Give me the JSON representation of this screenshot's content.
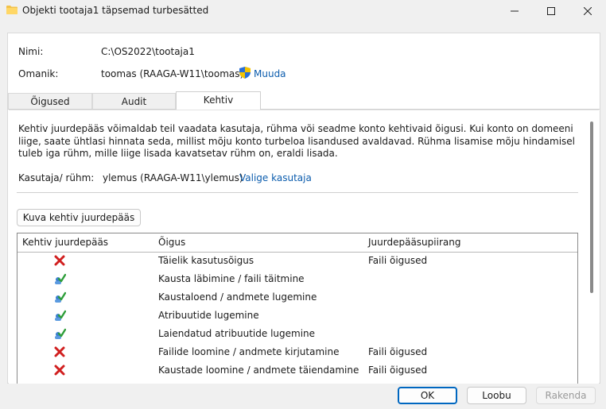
{
  "window": {
    "title": "Objekti tootaja1 täpsemad turbesätted"
  },
  "header": {
    "name_label": "Nimi:",
    "name_value": "C:\\OS2022\\tootaja1",
    "owner_label": "Omanik:",
    "owner_value": "toomas (RAAGA-W11\\toomas)",
    "change_link": "Muuda"
  },
  "tabs": [
    {
      "label": "Õigused"
    },
    {
      "label": "Audit"
    },
    {
      "label": "Kehtiv juurdepääs"
    }
  ],
  "content": {
    "description": "Kehtiv juurdepääs võimaldab teil vaadata kasutaja, rühma või seadme konto kehtivaid õigusi. Kui konto on domeeni liige, saate ühtlasi hinnata seda, millist mõju konto turbeloa lisandused avaldavad. Rühma lisamise mõju hindamisel tuleb iga rühm, mille liige lisada kavatsetav rühm on, eraldi lisada.",
    "user_label": "Kasutaja/ rühm:",
    "user_value": "ylemus (RAAGA-W11\\ylemus)",
    "select_user_link": "Valige kasutaja",
    "show_button": "Kuva kehtiv juurdepääs"
  },
  "table": {
    "headers": [
      "Kehtiv juurdepääs",
      "Õigus",
      "Juurdepääsupiirang"
    ],
    "rows": [
      {
        "access": "denied",
        "permission": "Täielik kasutusõigus",
        "limit": "Faili õigused"
      },
      {
        "access": "allowed",
        "permission": "Kausta läbimine / faili täitmine",
        "limit": ""
      },
      {
        "access": "allowed",
        "permission": "Kaustaloend / andmete lugemine",
        "limit": ""
      },
      {
        "access": "allowed",
        "permission": "Atribuutide lugemine",
        "limit": ""
      },
      {
        "access": "allowed",
        "permission": "Laiendatud atribuutide lugemine",
        "limit": ""
      },
      {
        "access": "denied",
        "permission": "Failide loomine / andmete kirjutamine",
        "limit": "Faili õigused"
      },
      {
        "access": "denied",
        "permission": "Kaustade loomine / andmete täiendamine",
        "limit": "Faili õigused"
      }
    ]
  },
  "footer": {
    "ok": "OK",
    "cancel": "Loobu",
    "apply": "Rakenda"
  },
  "colors": {
    "link": "#0b5cad",
    "accent": "#0067c0",
    "deny": "#d11f1f"
  }
}
